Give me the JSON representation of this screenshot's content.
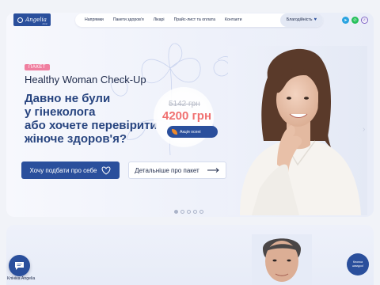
{
  "header": {
    "logo_text": "Angelia",
    "logo_sub": "clinic",
    "nav": [
      "Напрямки",
      "Пакети здоров'я",
      "Лікарі",
      "Прайс-лист та оплата",
      "Контакти"
    ],
    "charity_label": "Благодійність",
    "socials": [
      {
        "name": "telegram-icon",
        "glyph": "➤"
      },
      {
        "name": "whatsapp-icon",
        "glyph": "✆"
      },
      {
        "name": "viber-icon",
        "glyph": "✆"
      }
    ]
  },
  "hero": {
    "badge": "ПАКЕТ",
    "subtitle": "Healthy Woman Check-Up",
    "headline_lines": [
      "Давно не були",
      "у гінеколога",
      "або хочете перевірити",
      "жіноче здоров'я?"
    ],
    "old_price": "5142 грн",
    "new_price": "4200 грн",
    "promo_label": "Акція осені",
    "primary_button": "Хочу подбати про себе",
    "secondary_button": "Детальніше про пакет",
    "slides_count": 5,
    "active_slide": 1
  },
  "chat": {
    "label": "Клініка Angelia"
  },
  "emergency": {
    "line1": "Кнопка",
    "line2": "швидкої"
  },
  "colors": {
    "brand": "#2a4f9c",
    "price_accent": "#f07070",
    "badge": "#f07fa0",
    "promo_leaf": "#f08a2a"
  }
}
